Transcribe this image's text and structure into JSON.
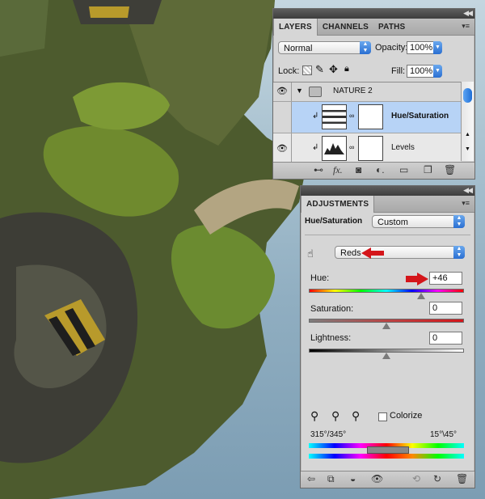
{
  "layers_panel": {
    "tabs": [
      "LAYERS",
      "CHANNELS",
      "PATHS"
    ],
    "blend_mode": "Normal",
    "opacity_label": "Opacity:",
    "opacity_value": "100%",
    "lock_label": "Lock:",
    "fill_label": "Fill:",
    "fill_value": "100%",
    "group_name": "NATURE 2",
    "layers": [
      {
        "name": "Hue/Saturation",
        "selected": true
      },
      {
        "name": "Levels",
        "selected": false
      }
    ],
    "footer_icons": [
      "link-icon",
      "fx-icon",
      "mask-icon",
      "adjustment-icon",
      "folder-icon",
      "new-layer-icon",
      "trash-icon"
    ]
  },
  "adjustments_panel": {
    "tab": "ADJUSTMENTS",
    "title": "Hue/Saturation",
    "preset": "Custom",
    "channel": "Reds",
    "hue_label": "Hue:",
    "hue_value": "+46",
    "saturation_label": "Saturation:",
    "saturation_value": "0",
    "lightness_label": "Lightness:",
    "lightness_value": "0",
    "colorize_label": "Colorize",
    "colorize_checked": false,
    "range_left": "315°/345°",
    "range_right": "15°\\45°",
    "footer_icons": [
      "back-icon",
      "clip-icon",
      "visibility-toggle-icon",
      "eye-icon",
      "previous-state-icon",
      "reset-icon",
      "trash-icon"
    ]
  },
  "colors": {
    "panel_bg": "#d6d6d6",
    "selection": "#b7d3f6",
    "annotation_arrow": "#d4151a",
    "accent_blue": "#2a6fd2"
  }
}
